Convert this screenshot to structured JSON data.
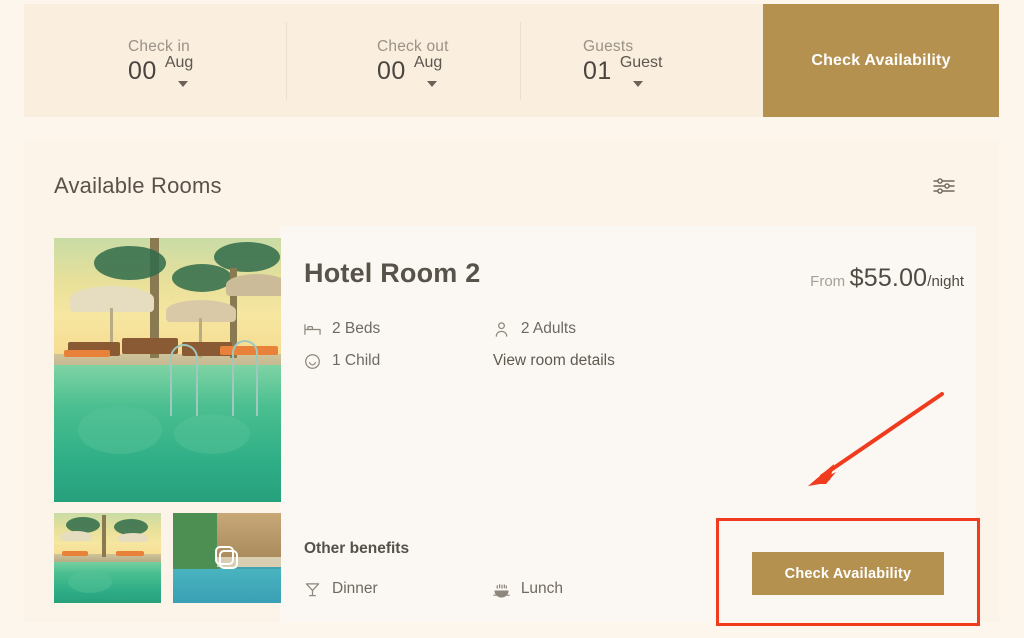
{
  "booking_bar": {
    "fields": [
      {
        "label": "Check in",
        "value": "00",
        "unit": "Aug",
        "caret": "chevron-down-icon"
      },
      {
        "label": "Check out",
        "value": "00",
        "unit": "Aug",
        "caret": "chevron-down-icon"
      },
      {
        "label": "Guests",
        "value": "01",
        "unit": "Guest",
        "caret": "chevron-down-icon"
      }
    ],
    "cta_label": "Check Availability",
    "cta_color": "#B59150",
    "background": "#FAEEDE"
  },
  "rooms_section": {
    "title": "Available Rooms",
    "filter_icon": "sliders-filter-icon",
    "card_background": "#FDF4E9"
  },
  "room": {
    "title": "Hotel Room 2",
    "price": {
      "prefix": "From",
      "amount": "$55.00",
      "unit": "/night"
    },
    "features": [
      {
        "icon": "bed-icon",
        "label": "2 Beds"
      },
      {
        "icon": "person-icon",
        "label": "2 Adults"
      },
      {
        "icon": "child-face-icon",
        "label": "1 Child"
      }
    ],
    "details_link": "View room details",
    "benefits_title": "Other benefits",
    "benefits": [
      {
        "icon": "cocktail-glass-icon",
        "label": "Dinner"
      },
      {
        "icon": "bowl-icon",
        "label": "Lunch"
      }
    ],
    "cta_label": "Check Availability",
    "gallery": {
      "hero_alt": "resort-pool-sunset-photo",
      "thumbnails": [
        {
          "alt": "resort-pool-sunset-thumbnail",
          "badge": null
        },
        {
          "alt": "resort-poolside-thumbnail",
          "badge": "gallery-images-icon"
        }
      ]
    }
  },
  "annotations": {
    "highlight_color": "#F03B1E",
    "arrow": "red-pointer-arrow",
    "box": "red-highlight-box"
  }
}
